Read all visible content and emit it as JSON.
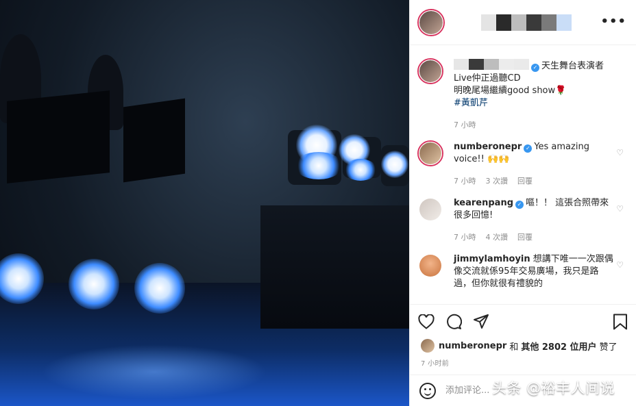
{
  "post": {
    "image_description": "",
    "author_avatar_icon": "author-avatar",
    "more_icon": "more-icon",
    "more_label": "•••"
  },
  "caption": {
    "title_text": "天生舞台表演者",
    "line1": "Live仲正過聽CD",
    "line2": "明晚尾場繼續good show🌹",
    "hashtag": "#黃凱芹",
    "time": "7 小時"
  },
  "comments": [
    {
      "user": "numberonepr",
      "verified": true,
      "text": "Yes amazing voice!! 🙌🙌",
      "time": "7 小時",
      "likes": "3 次讚",
      "reply": "回覆"
    },
    {
      "user": "kearenpang",
      "verified": true,
      "text": "嘔！！ 這張合照帶來很多回憶!",
      "time": "7 小時",
      "likes": "4 次讚",
      "reply": "回覆"
    },
    {
      "user": "jimmylamhoyin",
      "verified": false,
      "text": "想講下唯一一次跟偶像交流就係95年交易廣場，我只是路過，但你就很有禮貌的",
      "time": "",
      "likes": "",
      "reply": ""
    }
  ],
  "likes": {
    "user": "numberonepr",
    "and": "和",
    "count_text": "其他 2802 位用户",
    "suffix": "赞了"
  },
  "time_ago": "7 小时前",
  "add_comment": {
    "placeholder": "添加评论..."
  },
  "watermark": "头条 @裕丰人间说",
  "colors": {
    "accent": "#3897f0",
    "ring": "#d8345f",
    "text": "#262626",
    "muted": "#8e8e8e"
  }
}
